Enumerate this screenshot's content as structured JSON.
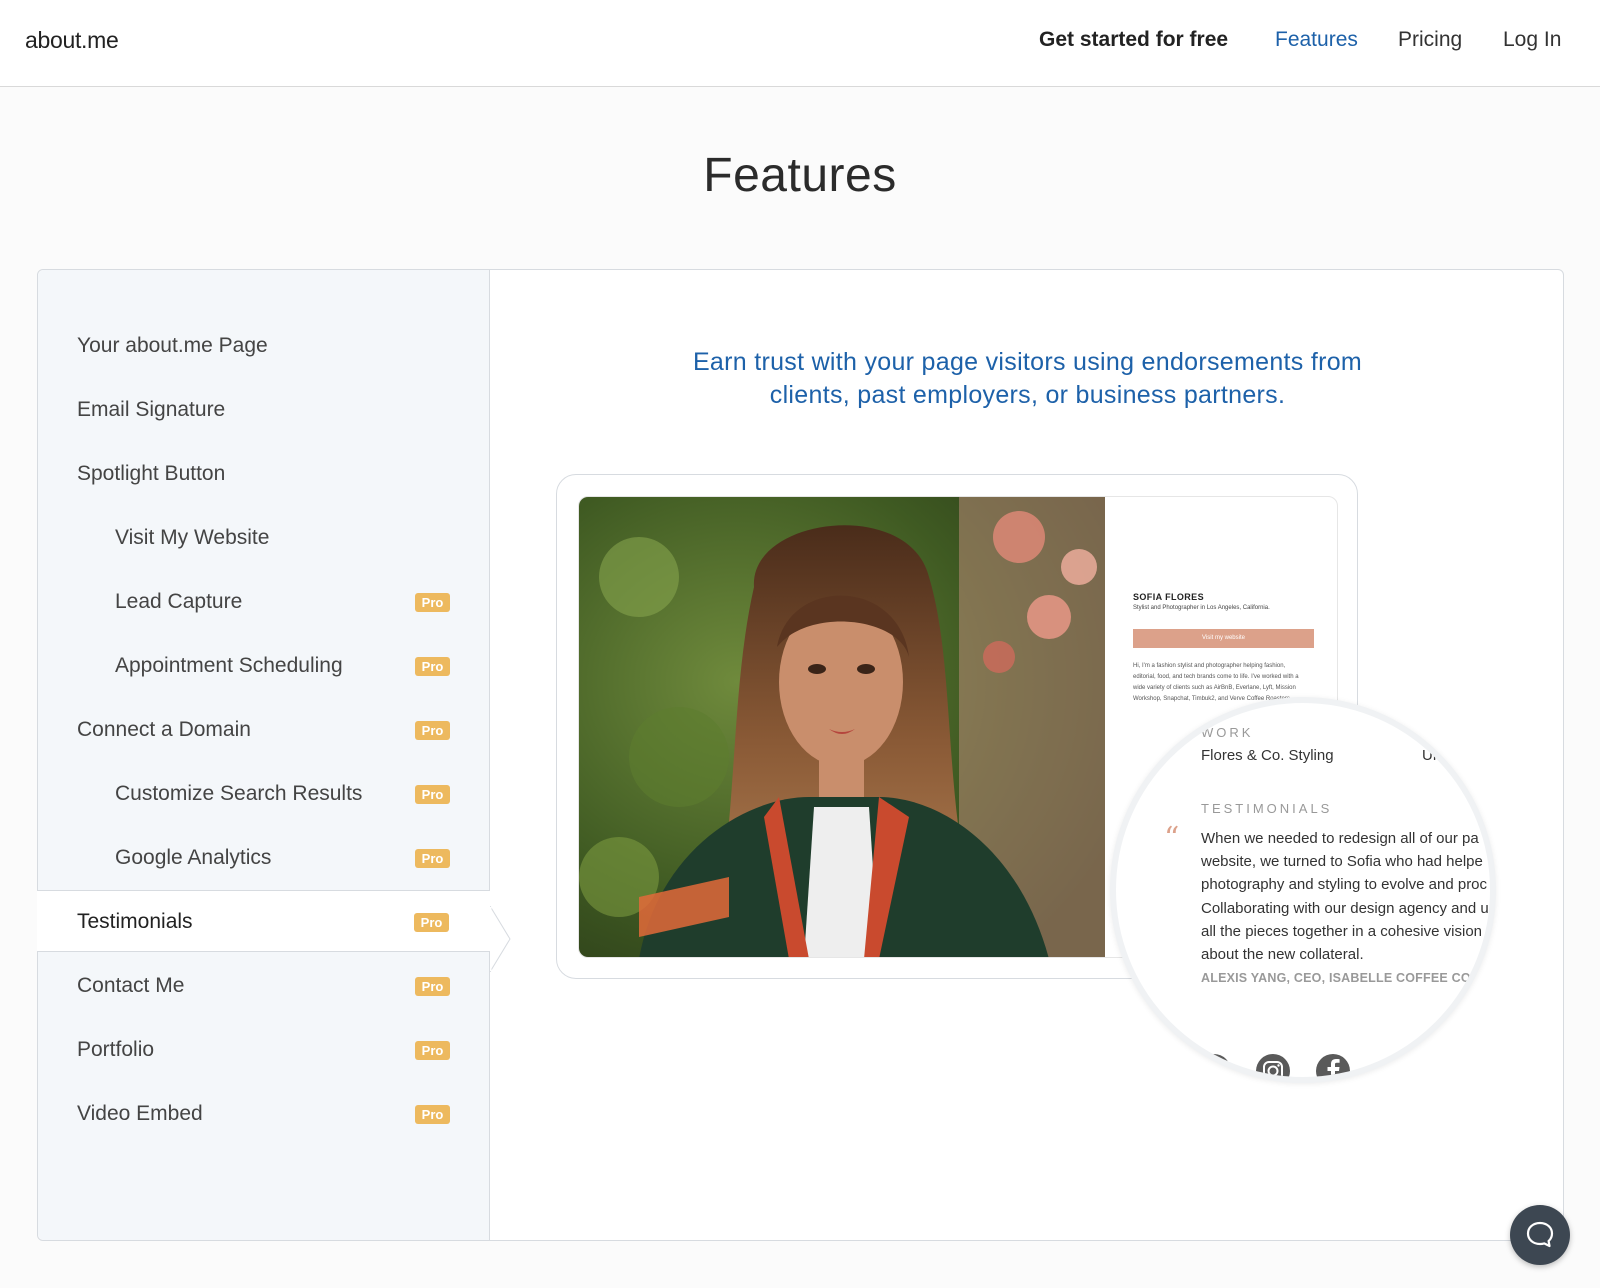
{
  "header": {
    "logo": "about.me",
    "nav": {
      "get_started": "Get started for free",
      "features": "Features",
      "pricing": "Pricing",
      "login": "Log In"
    }
  },
  "page": {
    "title": "Features"
  },
  "sidebar": {
    "items": [
      {
        "label": "Your about.me Page",
        "pro": false
      },
      {
        "label": "Email Signature",
        "pro": false
      },
      {
        "label": "Spotlight Button",
        "pro": false
      },
      {
        "label": "Visit My Website",
        "pro": false
      },
      {
        "label": "Lead Capture",
        "pro": true
      },
      {
        "label": "Appointment Scheduling",
        "pro": true
      },
      {
        "label": "Connect a Domain",
        "pro": true
      },
      {
        "label": "Customize Search Results",
        "pro": true
      },
      {
        "label": "Google Analytics",
        "pro": true
      },
      {
        "label": "Testimonials",
        "pro": true,
        "active": true
      },
      {
        "label": "Contact Me",
        "pro": true
      },
      {
        "label": "Portfolio",
        "pro": true
      },
      {
        "label": "Video Embed",
        "pro": true
      }
    ],
    "pro_badge": "Pro"
  },
  "content": {
    "headline_line1": "Earn trust with your page visitors using endorsements from",
    "headline_line2": "clients, past employers, or business partners.",
    "preview": {
      "name": "SOFIA FLORES",
      "subtitle": "Stylist and Photographer in Los Angeles, California.",
      "button": "Visit my website",
      "bio": "Hi, I'm a fashion stylist and photographer helping fashion, editorial, food, and tech brands come to life. I've worked with a wide variety of clients such as AirBnB, Everlane, Lyft, Mission Workshop, Snapchat, Timbuk2, and Verve Coffee Roasters."
    },
    "magnifier": {
      "work_title": "WORK",
      "work_item": "Flores & Co. Styling",
      "work_item2": "Ur",
      "testimonials_title": "TESTIMONIALS",
      "quote_lines": [
        "When we needed to redesign all of our pa",
        "website, we turned to Sofia who had helpe",
        "photography and styling to evolve and proc",
        "Collaborating with our design agency and u",
        "all the pieces together in a cohesive vision",
        "about the new collateral."
      ],
      "author": "ALEXIS YANG, CEO, ISABELLE COFFEE COM'",
      "icons": [
        "twitter-icon",
        "instagram-icon",
        "facebook-icon"
      ]
    }
  },
  "colors": {
    "accent": "#1d61a9",
    "pro_badge": "#edb95e",
    "sidebar_bg": "#f4f7fa",
    "preview_button": "#dca18a",
    "chat_bubble": "#3d4752"
  }
}
